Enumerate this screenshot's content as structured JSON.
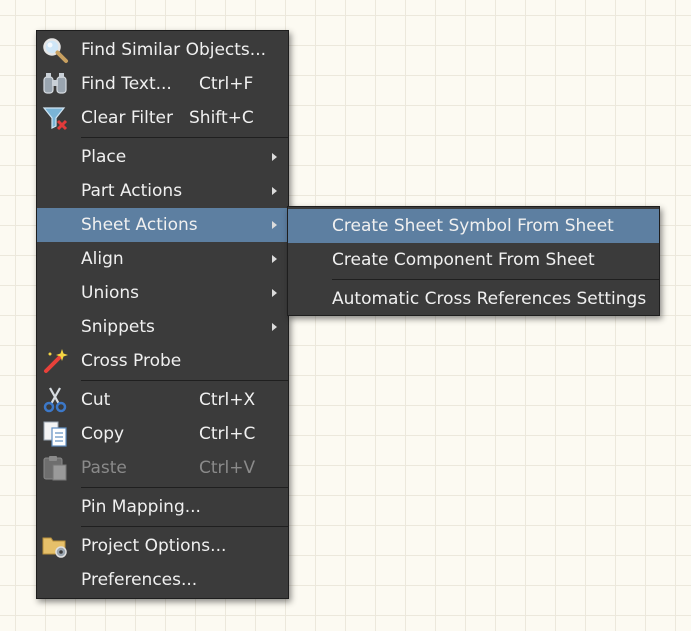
{
  "context_menu": {
    "items": [
      {
        "id": "find_similar",
        "label": "Find Similar Objects...",
        "icon": "magnifier-icon"
      },
      {
        "id": "find_text",
        "label": "Find Text...",
        "shortcut": "Ctrl+F",
        "icon": "binoculars-icon"
      },
      {
        "id": "clear_filter",
        "label": "Clear Filter",
        "shortcut": "Shift+C",
        "icon": "clear-filter-icon"
      },
      {
        "id": "place",
        "label": "Place",
        "submenu": true
      },
      {
        "id": "part_actions",
        "label": "Part Actions",
        "submenu": true
      },
      {
        "id": "sheet_actions",
        "label": "Sheet Actions",
        "submenu": true,
        "highlighted": true
      },
      {
        "id": "align",
        "label": "Align",
        "submenu": true
      },
      {
        "id": "unions",
        "label": "Unions",
        "submenu": true
      },
      {
        "id": "snippets",
        "label": "Snippets",
        "submenu": true
      },
      {
        "id": "cross_probe",
        "label": "Cross Probe",
        "icon": "cross-probe-wand-icon"
      },
      {
        "id": "cut",
        "label": "Cut",
        "shortcut": "Ctrl+X",
        "icon": "scissors-icon"
      },
      {
        "id": "copy",
        "label": "Copy",
        "shortcut": "Ctrl+C",
        "icon": "copy-icon"
      },
      {
        "id": "paste",
        "label": "Paste",
        "shortcut": "Ctrl+V",
        "icon": "paste-icon",
        "disabled": true
      },
      {
        "id": "pin_mapping",
        "label": "Pin Mapping..."
      },
      {
        "id": "project_options",
        "label": "Project Options...",
        "icon": "folder-gear-icon"
      },
      {
        "id": "preferences",
        "label": "Preferences..."
      }
    ]
  },
  "submenu": {
    "parent": "Sheet Actions",
    "items": [
      {
        "id": "create_sheet_symbol",
        "label": "Create Sheet Symbol From Sheet",
        "highlighted": true
      },
      {
        "id": "create_component",
        "label": "Create Component From Sheet"
      },
      {
        "id": "auto_cross_ref",
        "label": "Automatic Cross References Settings"
      }
    ]
  },
  "colors": {
    "menu_background": "#3b3b3b",
    "highlight": "#5d7fa1",
    "text": "#f0f0f0",
    "disabled_text": "#8a8a8a",
    "canvas": "#fcfaf2"
  }
}
